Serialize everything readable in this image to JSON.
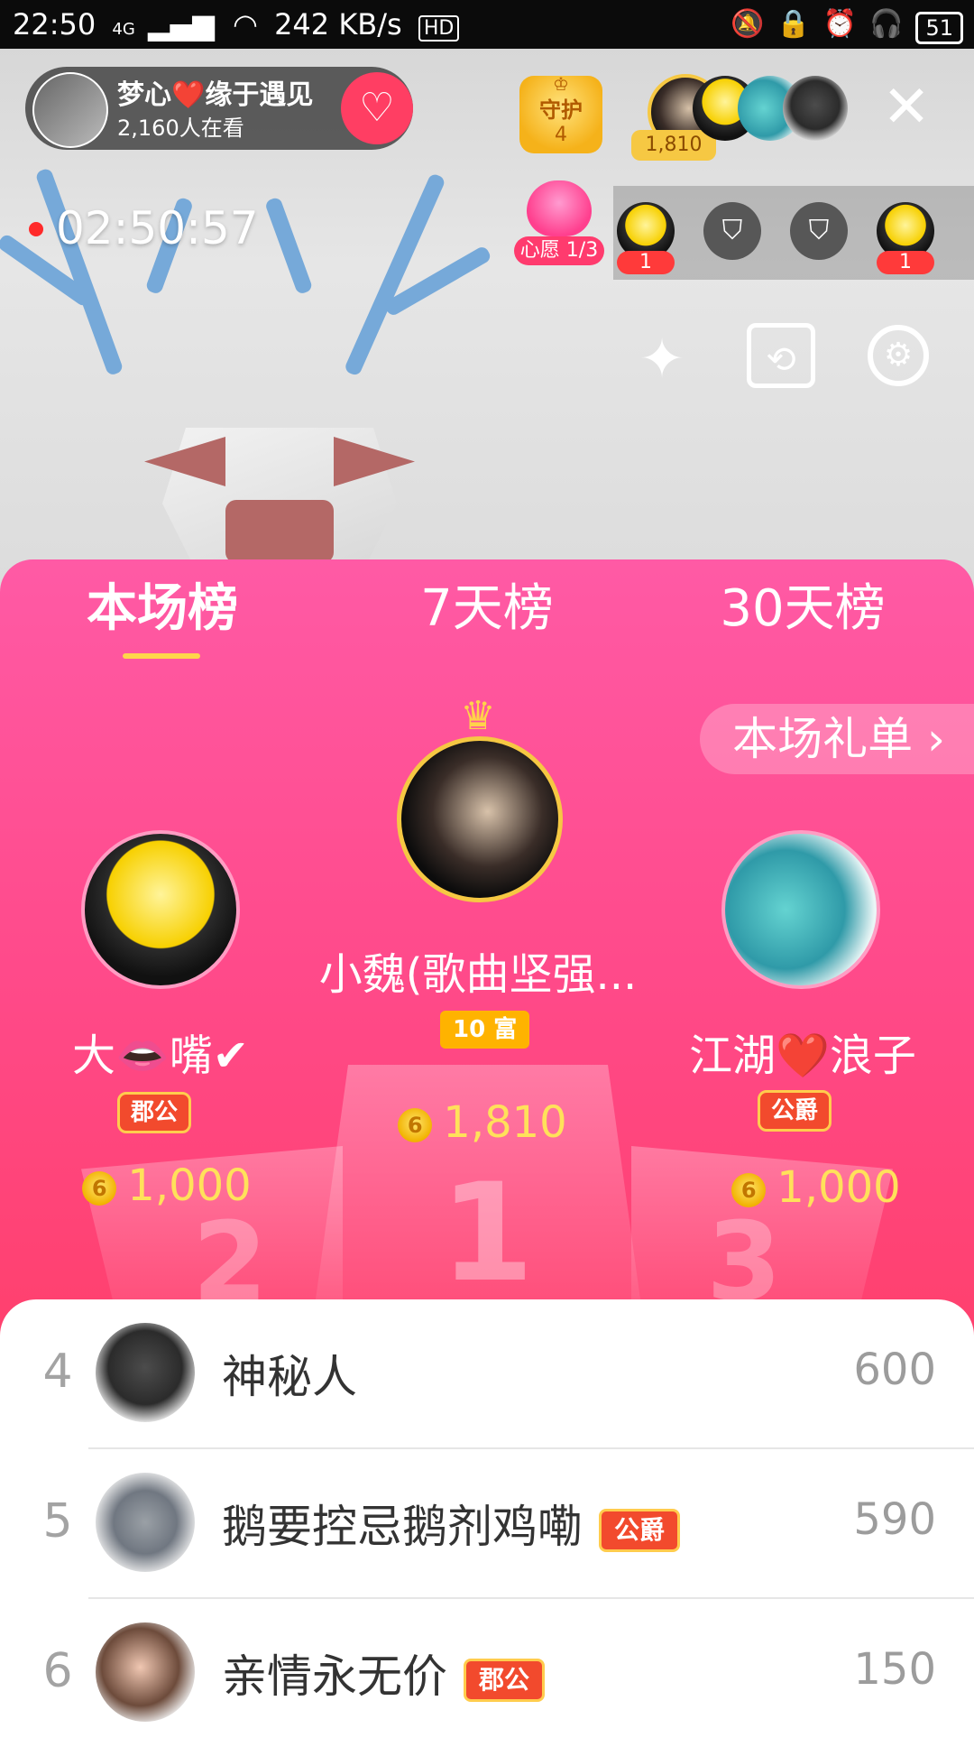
{
  "status_bar": {
    "time": "22:50",
    "network": "4G",
    "speed": "242 KB/s",
    "hd": "HD",
    "battery": "51"
  },
  "host": {
    "name": "梦心❤️缘于遇见",
    "viewers": "2,160人在看"
  },
  "guard": {
    "label": "守护",
    "count": "4"
  },
  "top_contributor_score": "1,810",
  "timer": "02:50:57",
  "wish": {
    "label": "心愿",
    "progress": "1/3"
  },
  "mic_seats": [
    {
      "count": "1"
    },
    {
      "count": ""
    },
    {
      "count": ""
    },
    {
      "count": "1"
    }
  ],
  "tabs": [
    "本场榜",
    "7天榜",
    "30天榜"
  ],
  "gift_list_label": "本场礼单 ›",
  "podium": {
    "first": {
      "name": "小魏(歌曲坚强...",
      "badge": "10 富",
      "amount": "1,810",
      "number": "1"
    },
    "second": {
      "name": "大👄嘴✔",
      "badge": "郡公",
      "amount": "1,000",
      "number": "2"
    },
    "third": {
      "name": "江湖❤️浪子",
      "badge": "公爵",
      "amount": "1,000",
      "number": "3"
    }
  },
  "ranking_list": [
    {
      "rank": "4",
      "name": "神秘人",
      "badge": "",
      "score": "600"
    },
    {
      "rank": "5",
      "name": "鹅要控忌鹅剂鸡嘞",
      "badge": "公爵",
      "score": "590"
    },
    {
      "rank": "6",
      "name": "亲情永无价",
      "badge": "郡公",
      "score": "150"
    }
  ],
  "colors": {
    "panel_top": "#ff5aa5",
    "panel_bottom": "#ff3f60",
    "gold": "#ffe15a",
    "badge_red": "#f24a2d"
  }
}
